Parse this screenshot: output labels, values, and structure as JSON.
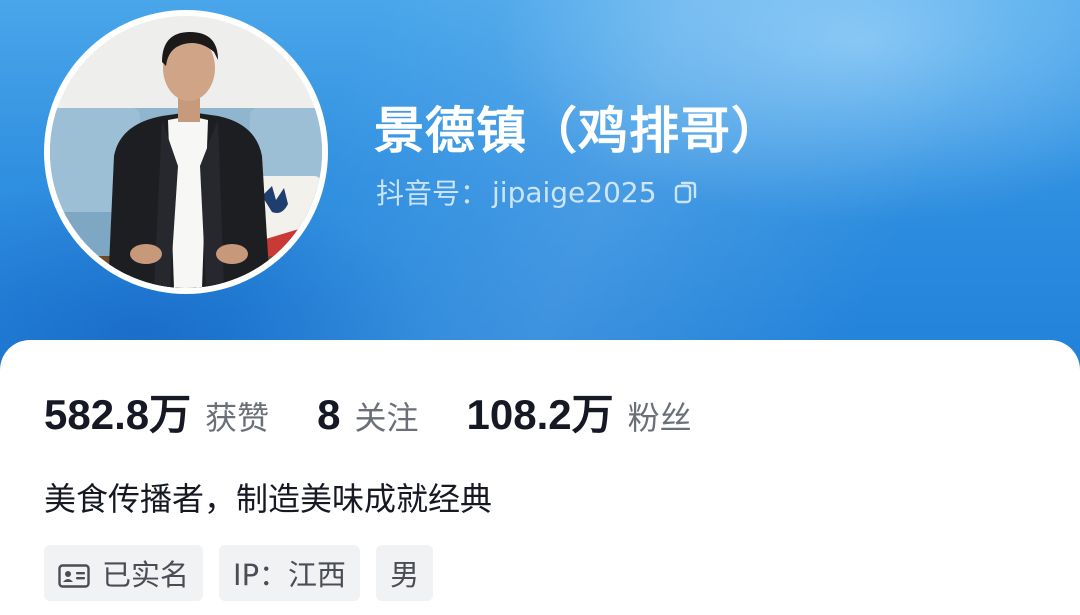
{
  "profile": {
    "nickname": "景德镇（鸡排哥）",
    "account_label": "抖音号：",
    "account_id": "jipaige2025",
    "avatar_icon": "profile-photo",
    "copy_icon": "copy-icon"
  },
  "stats": [
    {
      "value": "582.8万",
      "label": "获赞"
    },
    {
      "value": "8",
      "label": "关注"
    },
    {
      "value": "108.2万",
      "label": "粉丝"
    }
  ],
  "bio": "美食传播者，制造美味成就经典",
  "tags": {
    "verified": "已实名",
    "verified_icon": "id-card-icon",
    "ip": "IP：江西",
    "gender": "男"
  },
  "colors": {
    "header_top": "#4aa6ea",
    "header_bottom": "#1f7fd8",
    "text_primary": "#161823",
    "text_secondary": "#6b6f78",
    "tag_bg": "#f1f2f4"
  }
}
